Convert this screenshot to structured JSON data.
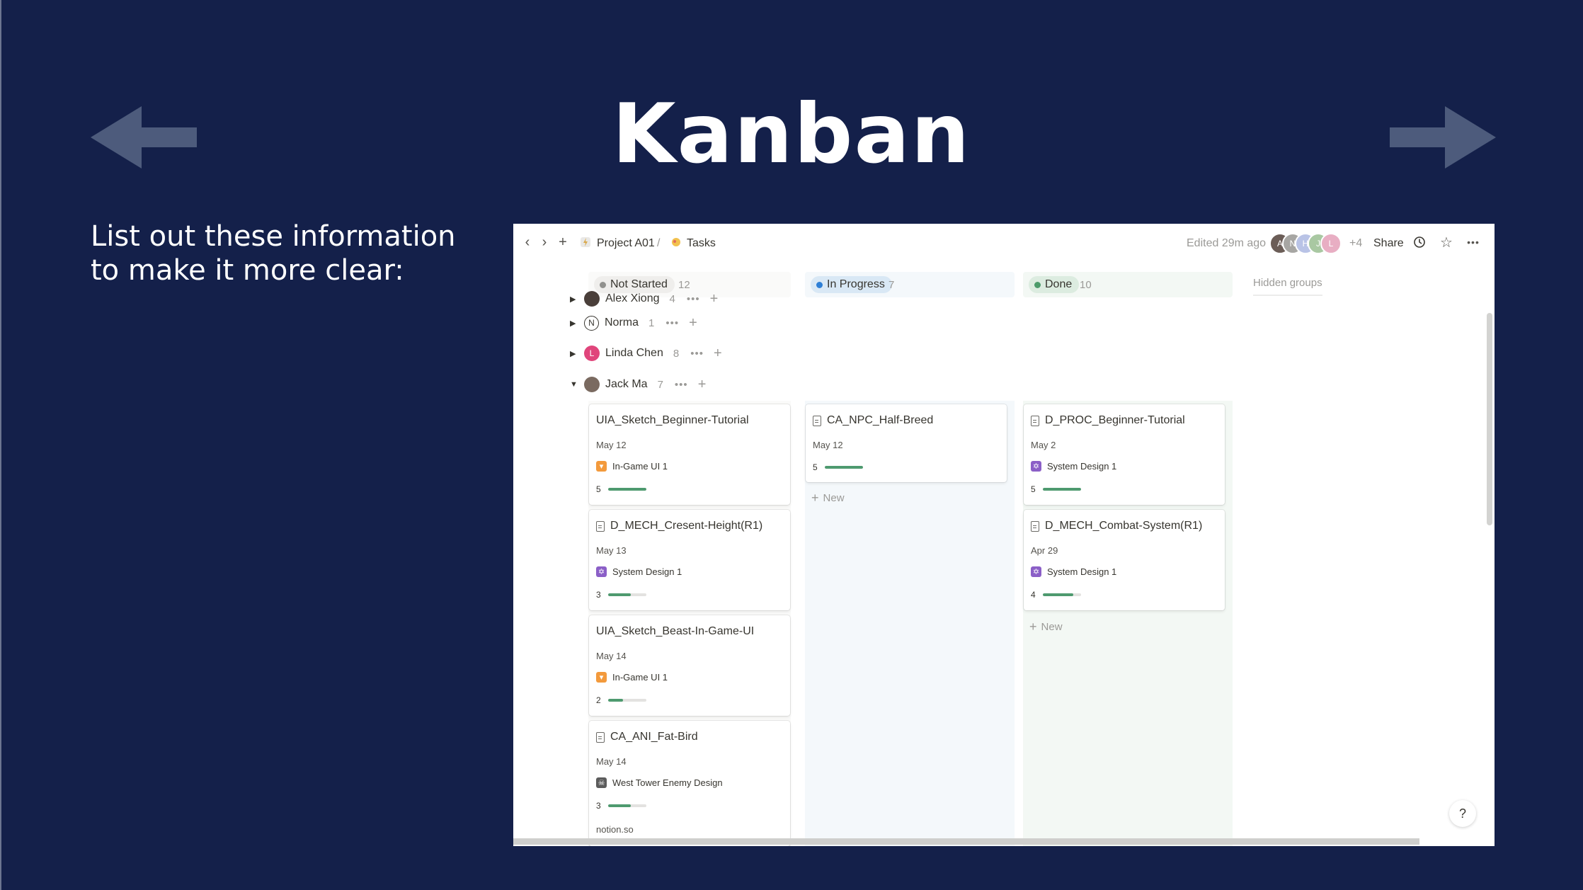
{
  "slide": {
    "title": "Kanban",
    "caption_line1": "List out these information",
    "caption_line2": "to make it more clear:",
    "arrow_color": "#4d5b7c"
  },
  "app": {
    "breadcrumb": {
      "workspace": "Project A01",
      "separator": "/",
      "page": "Tasks"
    },
    "edited": "Edited 29m ago",
    "avatars": [
      "A",
      "N",
      "H",
      "J",
      "L"
    ],
    "more_count": "+4",
    "share_label": "Share"
  },
  "board": {
    "columns": [
      {
        "label": "Not Started",
        "count": "12",
        "color": "#91918e"
      },
      {
        "label": "In Progress",
        "count": "7",
        "color": "#2e7fd6"
      },
      {
        "label": "Done",
        "count": "10",
        "color": "#4c9b6a"
      }
    ],
    "hidden_groups": "Hidden groups",
    "groups": [
      {
        "name": "Alex Xiong",
        "count": "4"
      },
      {
        "name": "Norma",
        "count": "1",
        "initial": "N"
      },
      {
        "name": "Linda Chen",
        "count": "8",
        "initial": "L"
      },
      {
        "name": "Jack Ma",
        "count": "7"
      }
    ],
    "dots": "•••",
    "plus": "+",
    "new_label": "New",
    "cards_not_started": [
      {
        "title": "UIA_Sketch_Beginner-Tutorial",
        "date": "May 12",
        "tag": "In-Game UI 1",
        "progress": 5,
        "fill": 1.0
      },
      {
        "title": "D_MECH_Cresent-Height(R1)",
        "date": "May 13",
        "tag": "System Design 1",
        "progress": 3,
        "fill": 0.6
      },
      {
        "title": "UIA_Sketch_Beast-In-Game-UI",
        "date": "May 14",
        "tag": "In-Game UI 1",
        "progress": 2,
        "fill": 0.4
      },
      {
        "title": "CA_ANI_Fat-Bird",
        "date": "May 14",
        "tag": "West Tower Enemy Design",
        "progress": 3,
        "fill": 0.6,
        "footer": "notion.so"
      }
    ],
    "cards_in_progress": [
      {
        "title": "CA_NPC_Half-Breed",
        "date": "May 12",
        "progress": 5,
        "fill": 1.0
      }
    ],
    "cards_done": [
      {
        "title": "D_PROC_Beginner-Tutorial",
        "date": "May 2",
        "tag": "System Design 1",
        "progress": 5,
        "fill": 1.0
      },
      {
        "title": "D_MECH_Combat-System(R1)",
        "date": "Apr 29",
        "tag": "System Design 1",
        "progress": 4,
        "fill": 0.8
      }
    ],
    "help": "?"
  }
}
